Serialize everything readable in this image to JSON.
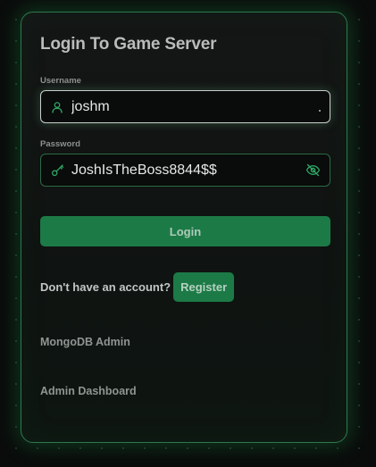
{
  "form": {
    "title": "Login To Game Server",
    "username": {
      "label": "Username",
      "value": "joshm",
      "icon": "user-icon"
    },
    "password": {
      "label": "Password",
      "value": "JoshIsTheBoss8844$$",
      "icon": "key-icon",
      "toggle_icon": "eye-off-icon"
    },
    "login_label": "Login",
    "register_prompt": "Don't have an account?",
    "register_label": "Register",
    "links": [
      {
        "label": "MongoDB Admin"
      },
      {
        "label": "Admin Dashboard"
      }
    ]
  },
  "colors": {
    "accent": "#1c7a47",
    "border": "#2c7a4d",
    "background": "#0a0c0b"
  }
}
